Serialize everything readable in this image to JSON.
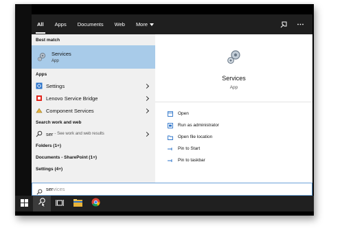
{
  "filter_tabs": [
    {
      "label": "All"
    },
    {
      "label": "Apps"
    },
    {
      "label": "Documents"
    },
    {
      "label": "Web"
    },
    {
      "label": "More"
    }
  ],
  "best_match": {
    "heading": "Best match",
    "title": "Services",
    "subtitle": "App"
  },
  "apps": {
    "heading": "Apps",
    "items": [
      {
        "label": "Settings"
      },
      {
        "label": "Lenovo Service Bridge"
      },
      {
        "label": "Component Services"
      }
    ]
  },
  "web": {
    "heading": "Search work and web",
    "query": "ser",
    "hint": "- See work and web results"
  },
  "groups": [
    {
      "label": "Folders (1+)"
    },
    {
      "label": "Documents - SharePoint (1+)"
    },
    {
      "label": "Settings (4+)"
    }
  ],
  "preview": {
    "title": "Services",
    "subtitle": "App"
  },
  "actions": [
    {
      "label": "Open",
      "icon": "open-icon"
    },
    {
      "label": "Run as administrator",
      "icon": "shield-icon"
    },
    {
      "label": "Open file location",
      "icon": "folder-icon"
    },
    {
      "label": "Pin to Start",
      "icon": "pin-icon"
    },
    {
      "label": "Pin to taskbar",
      "icon": "pin-icon"
    }
  ],
  "search": {
    "typed": "ser",
    "suggestion": "vices"
  },
  "colors": {
    "selected_bg": "#a8cbe9",
    "topbar_bg": "#1f1f1f",
    "taskbar_bg": "#202020",
    "search_border": "#6aa1d8"
  }
}
